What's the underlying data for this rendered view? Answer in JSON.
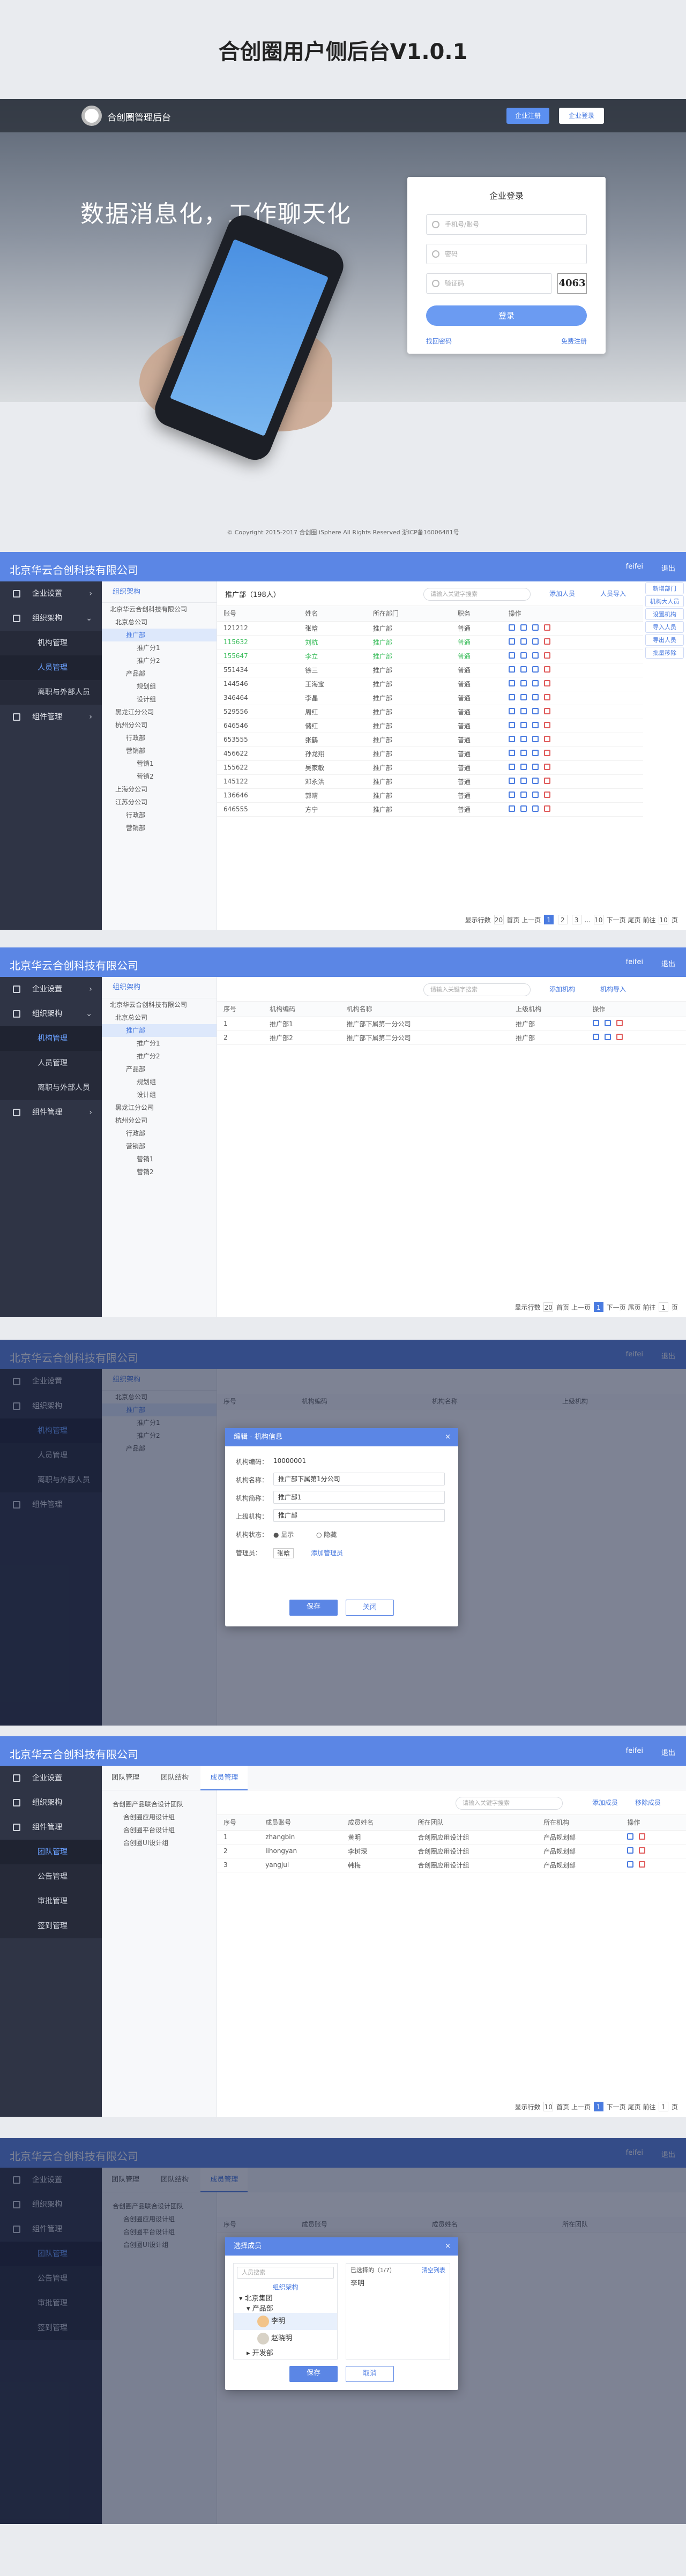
{
  "doc_title": "合创圈用户侧后台V1.0.1",
  "login": {
    "brand": "合创圈管理后台",
    "btn_register": "企业注册",
    "btn_login": "企业登录",
    "slogan": "数据消息化，工作聊天化",
    "card_title": "企业登录",
    "ph_account": "手机号/账号",
    "ph_password": "密码",
    "ph_captcha": "验证码",
    "captcha": "4063",
    "submit": "登录",
    "forgot": "找回密码",
    "register_link": "免费注册",
    "copyright": "© Copyright 2015-2017 合创圈 iSphere All Rights Reserved 浙ICP备16006481号"
  },
  "app": {
    "company": "北京华云合创科技有限公司",
    "user": "feifei",
    "logout": "退出",
    "menu": [
      "企业设置",
      "组织架构",
      "组件管理"
    ],
    "sub_org": [
      "机构管理",
      "人员管理",
      "离职与外部人员"
    ],
    "sub_team": [
      "团队管理",
      "公告管理",
      "审批管理",
      "签到管理"
    ]
  },
  "panel1": {
    "tree_title": "组织架构",
    "tree": [
      "北京华云合创科技有限公司",
      "北京总公司",
      "推广部",
      "推广分1",
      "推广分2",
      "产品部",
      "规划组",
      "设计组",
      "黑龙江分公司",
      "杭州分公司",
      "行政部",
      "营销部",
      "营销1",
      "营销2",
      "上海分公司",
      "江苏分公司",
      "行政部",
      "营销部"
    ],
    "header_label": "推广部（198人）",
    "search_ph": "请输入关键字搜索",
    "btn_add": "添加人员",
    "btn_import": "人员导入",
    "rail": [
      "新增部门",
      "机构大人员",
      "设置机构",
      "导入人员",
      "导出人员",
      "批量移除"
    ],
    "columns": [
      "账号",
      "姓名",
      "所在部门",
      "职务",
      "操作"
    ],
    "rows": [
      [
        "121212",
        "张晗",
        "推广部",
        "普通"
      ],
      [
        "115632",
        "刘杭",
        "推广部",
        "普通"
      ],
      [
        "155647",
        "李立",
        "推广部",
        "普通"
      ],
      [
        "551434",
        "徐三",
        "推广部",
        "普通"
      ],
      [
        "144546",
        "王海宝",
        "推广部",
        "普通"
      ],
      [
        "346464",
        "李晶",
        "推广部",
        "普通"
      ],
      [
        "529556",
        "周红",
        "推广部",
        "普通"
      ],
      [
        "646546",
        "储红",
        "推广部",
        "普通"
      ],
      [
        "653555",
        "张鹤",
        "推广部",
        "普通"
      ],
      [
        "456622",
        "孙龙翔",
        "推广部",
        "普通"
      ],
      [
        "155622",
        "吴家敏",
        "推广部",
        "普通"
      ],
      [
        "145122",
        "邓永洪",
        "推广部",
        "普通"
      ],
      [
        "136646",
        "郭晴",
        "推广部",
        "普通"
      ],
      [
        "646555",
        "方宁",
        "推广部",
        "普通"
      ]
    ],
    "pager": {
      "per": "显示行数",
      "per_val": "20",
      "first": "首页",
      "prev": "上一页",
      "pages": [
        "1",
        "2",
        "3",
        "...",
        "10"
      ],
      "next": "下一页",
      "last": "尾页",
      "goto": "前往",
      "goto_val": "10",
      "page": "页"
    }
  },
  "panel2": {
    "columns": [
      "序号",
      "机构编码",
      "机构名称",
      "上级机构",
      "操作"
    ],
    "rows": [
      [
        "1",
        "推广部1",
        "推广部下属第一分公司",
        "推广部"
      ],
      [
        "2",
        "推广部2",
        "推广部下属第二分公司",
        "推广部"
      ]
    ],
    "btn_add": "添加机构",
    "btn_import": "机构导入",
    "pager_per_val": "20",
    "pager_goto_val": "1"
  },
  "dialog1": {
    "title": "编辑 - 机构信息",
    "f_code_l": "机构编码：",
    "f_code_v": "10000001",
    "f_name_l": "机构名称：",
    "f_name_v": "推广部下属第1分公司",
    "f_short_l": "机构简称：",
    "f_short_v": "推广部1",
    "f_parent_l": "上级机构：",
    "f_parent_v": "推广部",
    "f_status_l": "机构状态：",
    "opt_show": "显示",
    "opt_hide": "隐藏",
    "f_admin_l": "管理员：",
    "admin_v": "张晗",
    "admin_add": "添加管理员",
    "save": "保存",
    "close": "关闭"
  },
  "panel3": {
    "tab_home": "团队管理",
    "tab_struct": "团队结构",
    "tab_member": "成员管理",
    "tree": [
      "合创圈产品联合设计团队",
      "合创圈应用设计组",
      "合创圈平台设计组",
      "合创圈UI设计组"
    ],
    "search_ph": "请输入关键字搜索",
    "btn_add": "添加成员",
    "btn_remove": "移除成员",
    "columns": [
      "序号",
      "成员账号",
      "成员姓名",
      "所在团队",
      "所在机构",
      "操作"
    ],
    "rows": [
      [
        "1",
        "zhangbin",
        "黄明",
        "合创圈应用设计组",
        "产品规划部"
      ],
      [
        "2",
        "lihongyan",
        "李树琛",
        "合创圈应用设计组",
        "产品规划部"
      ],
      [
        "3",
        "yangjul",
        "韩梅",
        "合创圈应用设计组",
        "产品规划部"
      ]
    ],
    "pager_per_val": "10",
    "pager_goto_val": "1"
  },
  "dialog2": {
    "title": "选择成员",
    "search_ph": "人员搜索",
    "tree_title": "组织架构",
    "left": [
      "北京集团",
      "产品部",
      "李明",
      "赵晓明",
      "开发部"
    ],
    "right_title": "已选择的（1/7）",
    "right_clear": "清空列表",
    "right_list": [
      "李明"
    ],
    "save": "保存",
    "cancel": "取消"
  }
}
